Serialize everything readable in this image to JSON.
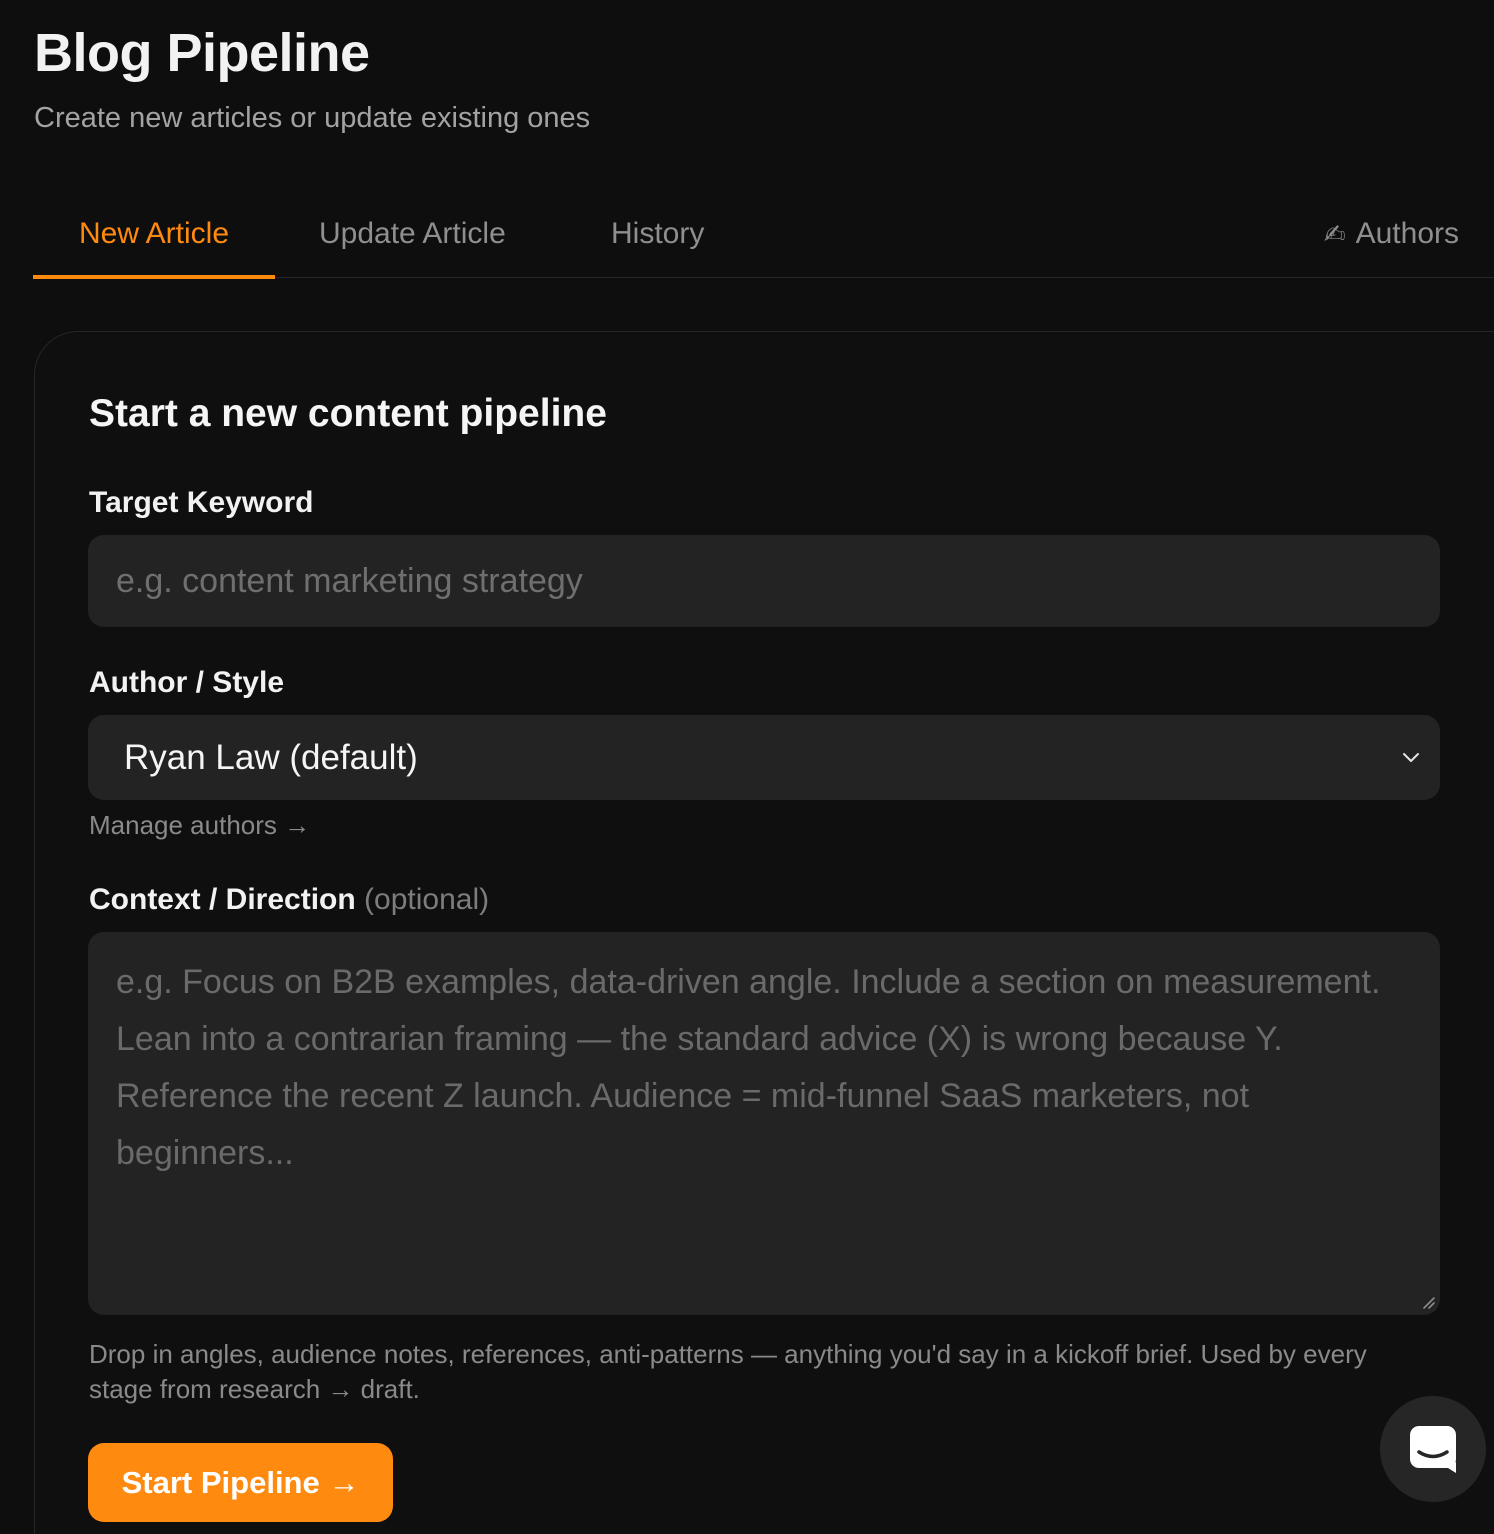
{
  "app": {
    "title": "Blog Pipeline",
    "subtitle": "Create new articles or update existing ones"
  },
  "tabs": [
    {
      "label": "New Article",
      "active": true
    },
    {
      "label": "Update Article",
      "active": false
    },
    {
      "label": "History",
      "active": false
    },
    {
      "label": "Authors",
      "icon": "✍",
      "active": false
    }
  ],
  "form": {
    "title": "Start a new content pipeline",
    "keyword": {
      "label": "Target Keyword",
      "value": "",
      "placeholder": "e.g. content marketing strategy"
    },
    "author": {
      "label": "Author / Style",
      "selected": "Ryan Law (default)",
      "manage_link": "Manage authors →"
    },
    "context": {
      "label": "Context / Direction",
      "optional": "(optional)",
      "value": "",
      "placeholder": "e.g. Focus on B2B examples, data-driven angle. Include a section on measurement. Lean into a contrarian framing — the standard advice (X) is wrong because Y. Reference the recent Z launch. Audience = mid-funnel SaaS marketers, not beginners...",
      "helper": "Drop in angles, audience notes, references, anti-patterns — anything you'd say in a kickoff brief. Used by every stage from research → draft."
    },
    "submit_label": "Start Pipeline →"
  },
  "colors": {
    "accent": "#ff8a10",
    "background": "#0e0e0e",
    "field": "#232323"
  }
}
